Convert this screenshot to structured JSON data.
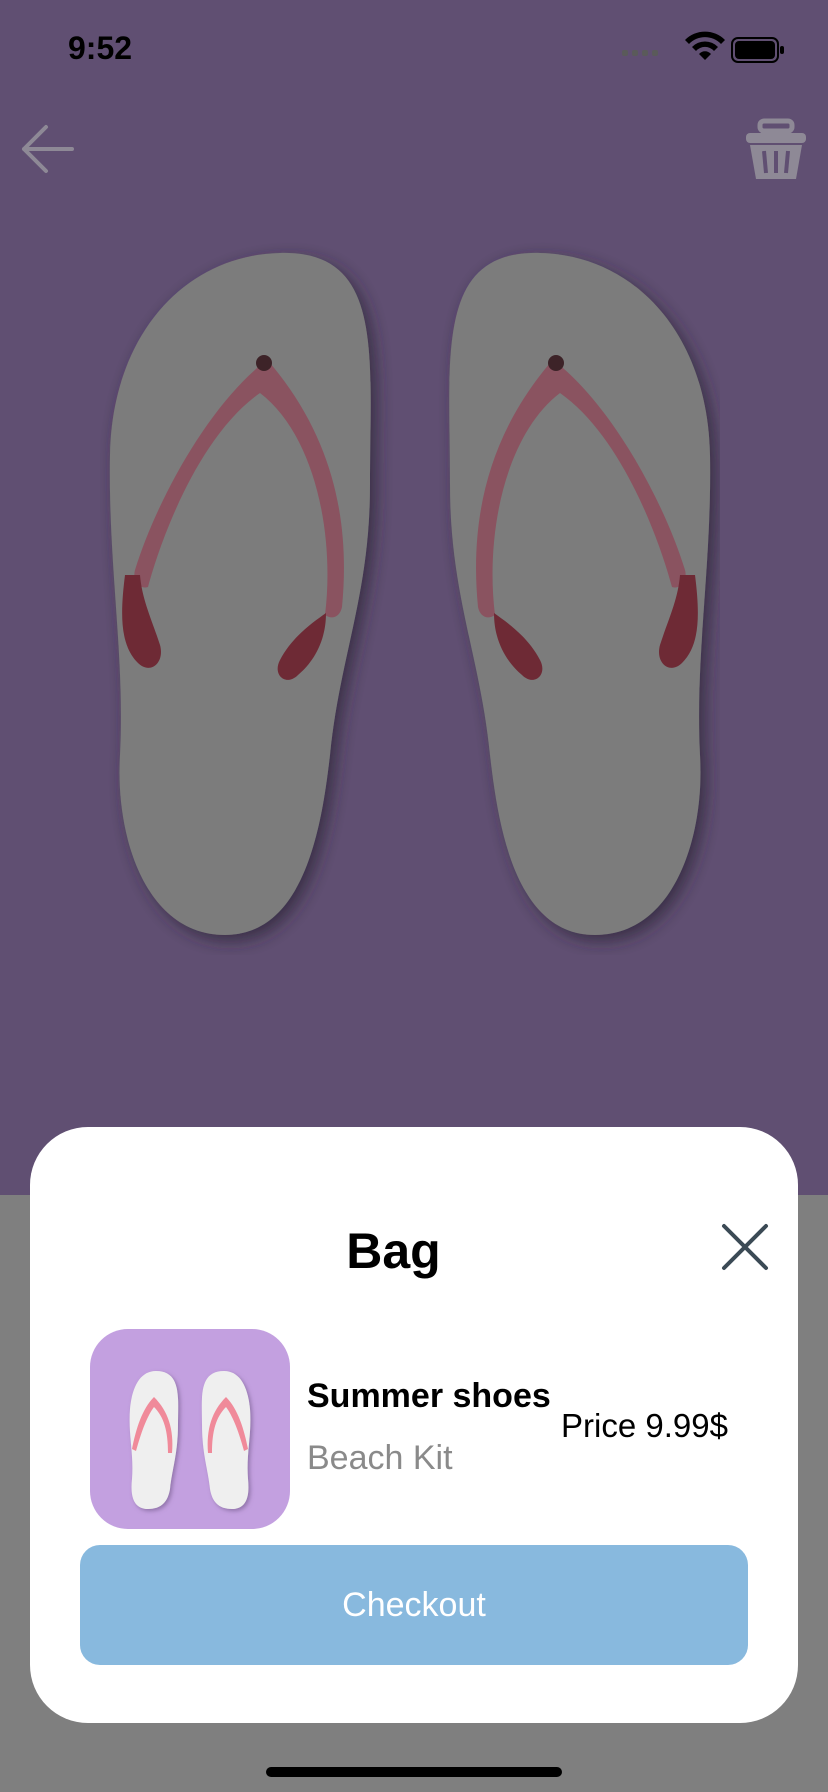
{
  "status_bar": {
    "time": "9:52",
    "icons": [
      "cellular-signal-icon",
      "wifi-icon",
      "battery-icon"
    ]
  },
  "nav": {
    "back_icon": "arrow-left-icon",
    "cart_icon": "basket-icon"
  },
  "product_hero": {
    "image": "flip-flops-image"
  },
  "bag_sheet": {
    "title": "Bag",
    "close_icon": "close-icon",
    "item": {
      "thumbnail": "flip-flops-thumbnail",
      "name": "Summer shoes",
      "subtitle": "Beach Kit",
      "price": "Price 9.99$"
    },
    "checkout_label": "Checkout"
  },
  "colors": {
    "hero_background": "#604f72",
    "dimmed_background": "#7f7f7f",
    "thumbnail_background": "#c3a0e0",
    "checkout_button": "#88b9de",
    "close_icon": "#3b4a55"
  }
}
